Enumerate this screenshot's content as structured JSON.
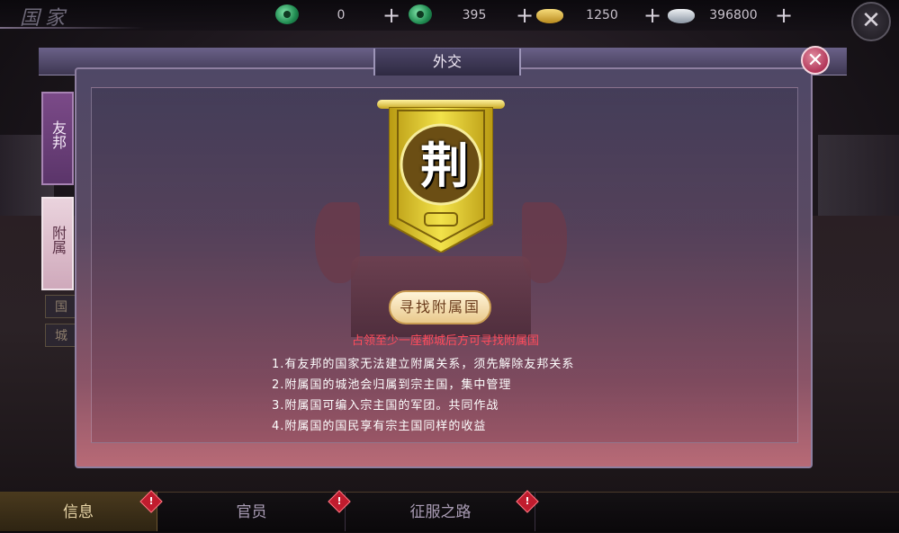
{
  "page": {
    "title": "国家"
  },
  "resources": [
    {
      "icon": "jade-icon",
      "value": "0"
    },
    {
      "icon": "locked-jade-icon",
      "value": "395"
    },
    {
      "icon": "gold-ingot-icon",
      "value": "1250"
    },
    {
      "icon": "silver-ingot-icon",
      "value": "396800"
    }
  ],
  "side_tabs": {
    "ally": "友邦",
    "vassal": "附属",
    "sub1": "国",
    "sub2": "城"
  },
  "dialog": {
    "title": "外交",
    "emblem_char": "荆",
    "find_button": "寻找附属国",
    "hint": "占领至少一座都城后方可寻找附属国",
    "rules": [
      "1.有友邦的国家无法建立附属关系，须先解除友邦关系",
      "2.附属国的城池会归属到宗主国，集中管理",
      "3.附属国可编入宗主国的军团。共同作战",
      "4.附属国的国民享有宗主国同样的收益"
    ]
  },
  "bottom_tabs": [
    {
      "label": "信息",
      "alert": "!"
    },
    {
      "label": "官员",
      "alert": "!"
    },
    {
      "label": "征服之路",
      "alert": "!"
    }
  ],
  "colors": {
    "banner_gold": "#e8d431",
    "hint_red": "#ff4c5c",
    "dialog_close": "#b23659"
  }
}
